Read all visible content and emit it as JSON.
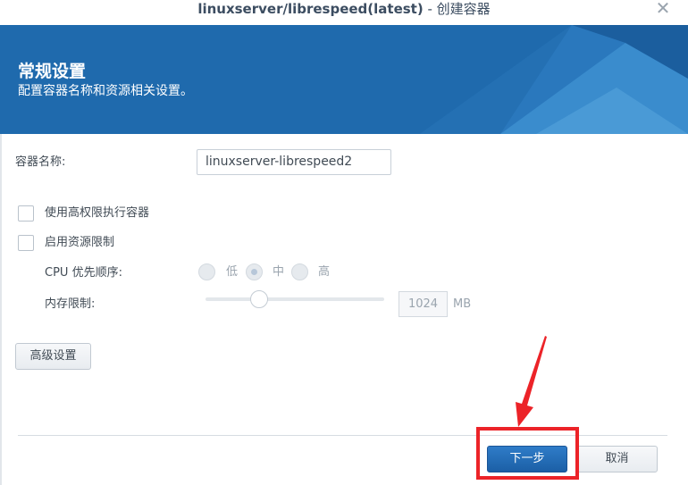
{
  "window": {
    "title_bold": "linuxserver/librespeed(latest)",
    "title_suffix": " - 创建容器",
    "close_glyph": "✕"
  },
  "banner": {
    "title": "常规设置",
    "subtitle": "配置容器名称和资源相关设置。",
    "color": "#1f6aad"
  },
  "form": {
    "container_name_label": "容器名称:",
    "container_name_value": "linuxserver-librespeed2",
    "privileged_label": "使用高权限执行容器",
    "privileged_checked": false,
    "resource_limit_label": "启用资源限制",
    "resource_limit_checked": false,
    "cpu_priority_label": "CPU 优先顺序:",
    "cpu_options": [
      "低",
      "中",
      "高"
    ],
    "cpu_selected": "中",
    "memory_label": "内存限制:",
    "memory_value": "1024",
    "memory_unit": "MB",
    "memory_slider_fraction": 0.25
  },
  "buttons": {
    "advanced": "高级设置",
    "next": "下一步",
    "cancel": "取消"
  },
  "annotation": {
    "highlight_color": "#ec2328"
  }
}
